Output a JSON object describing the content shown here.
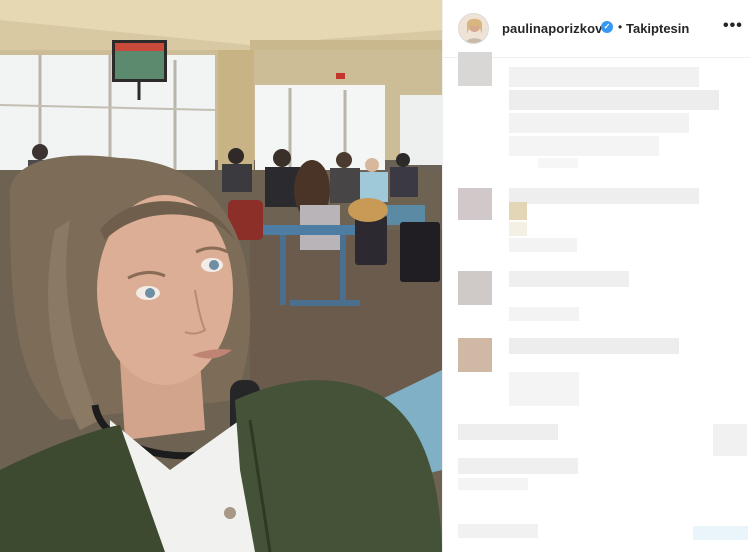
{
  "post": {
    "username": "paulinaporizkov",
    "follow_status": "Takiptesin",
    "separator": "•"
  },
  "icons": {
    "verified": "verified-badge-icon",
    "more": "more-options-icon"
  },
  "colors": {
    "verified_blue": "#3897f0",
    "text": "#262626",
    "border": "#efefef"
  }
}
